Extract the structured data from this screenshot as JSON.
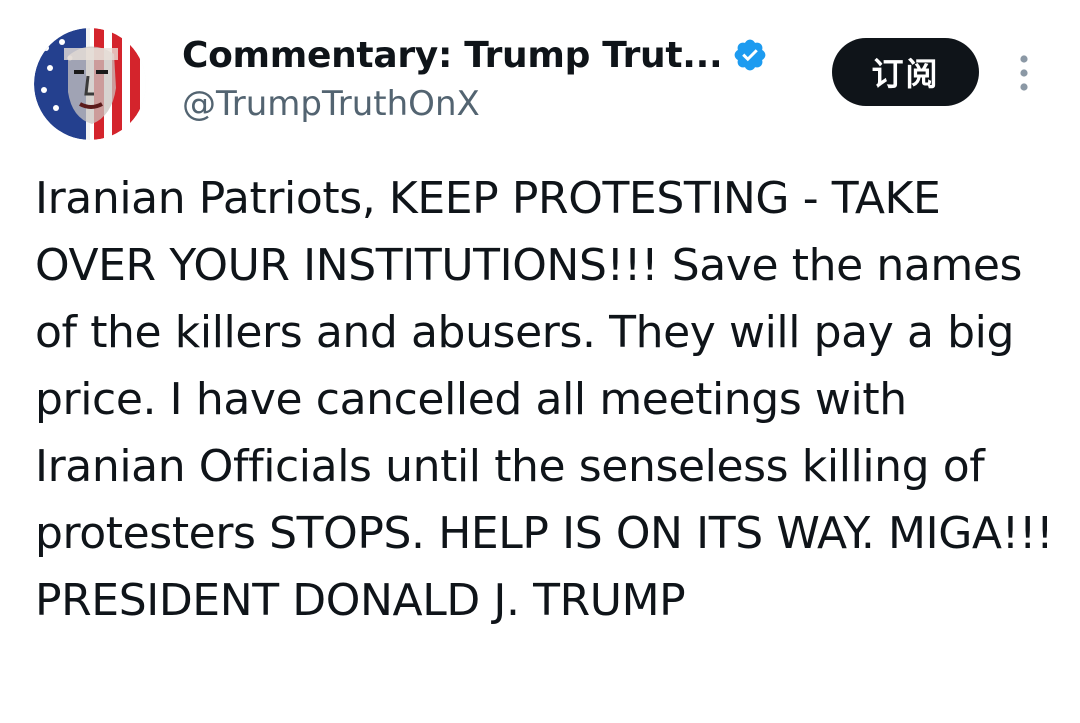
{
  "author": {
    "display_name": "Commentary: Trump Trut...",
    "handle": "@TrumpTruthOnX",
    "verified": true,
    "verified_color": "#1d9bf0"
  },
  "header": {
    "subscribe_label": "订阅"
  },
  "tweet": {
    "text": "Iranian Patriots, KEEP PROTESTING - TAKE OVER YOUR INSTITUTIONS!!! Save the names of the killers and abusers. They will pay a big price. I have cancelled all meetings with Iranian Officials until the senseless killing of protesters STOPS. HELP IS ON ITS WAY. MIGA!!! PRESIDENT DONALD J. TRUMP"
  },
  "icons": {
    "avatar": "avatar-flag-portrait",
    "verified": "verified-badge-icon",
    "more": "more-vertical-icon"
  },
  "colors": {
    "text_primary": "#0f1419",
    "text_secondary": "#536471",
    "button_bg": "#0f1419",
    "button_text": "#ffffff"
  }
}
